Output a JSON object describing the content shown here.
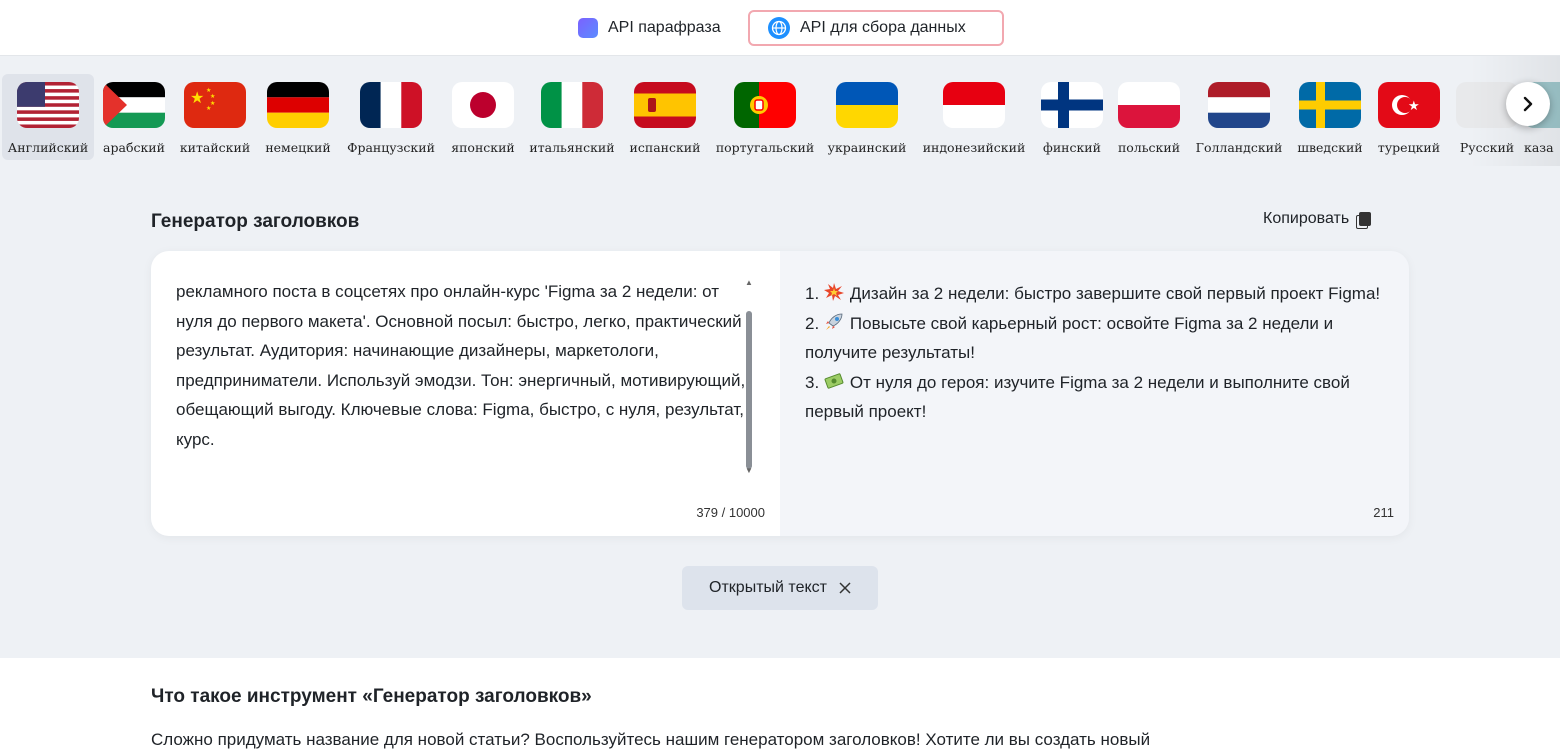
{
  "topbar": {
    "paraphrase_api": "API парафраза",
    "data_api": "API для сбора данных"
  },
  "languages": [
    {
      "label": "Английский",
      "flag": "us-flag-icon",
      "active": true
    },
    {
      "label": "арабский",
      "flag": "palestine-flag-icon"
    },
    {
      "label": "китайский",
      "flag": "china-flag-icon"
    },
    {
      "label": "немецкий",
      "flag": "germany-flag-icon"
    },
    {
      "label": "Французский",
      "flag": "france-flag-icon"
    },
    {
      "label": "японский",
      "flag": "japan-flag-icon"
    },
    {
      "label": "итальянский",
      "flag": "italy-flag-icon"
    },
    {
      "label": "испанский",
      "flag": "spain-flag-icon"
    },
    {
      "label": "португальский",
      "flag": "portugal-flag-icon"
    },
    {
      "label": "украинский",
      "flag": "ukraine-flag-icon"
    },
    {
      "label": "индонезийский",
      "flag": "indonesia-flag-icon"
    },
    {
      "label": "финский",
      "flag": "finland-flag-icon"
    },
    {
      "label": "польский",
      "flag": "poland-flag-icon"
    },
    {
      "label": "Голландский",
      "flag": "netherlands-flag-icon"
    },
    {
      "label": "шведский",
      "flag": "sweden-flag-icon"
    },
    {
      "label": "турецкий",
      "flag": "turkey-flag-icon"
    },
    {
      "label": "Русский",
      "flag": "russian-flag-icon"
    },
    {
      "label": "каза",
      "flag": "kazakhstan-flag-icon"
    }
  ],
  "tool": {
    "title": "Генератор заголовков",
    "copy_label": "Копировать",
    "input": "рекламного поста в соцсетях про онлайн-курс 'Figma за 2 недели: от нуля до первого макета'. Основной посыл: быстро, легко, практический результат. Аудитория: начинающие дизайнеры, маркетологи, предприниматели. Используй эмодзи. Тон: энергичный, мотивирующий, обещающий выгоду. Ключевые слова: Figma, быстро, с нуля, результат, курс.",
    "input_counter": "379 / 10000",
    "output": [
      {
        "num": "1.",
        "emoji": "collision-emoji-icon",
        "text": "Дизайн за 2 недели: быстро завершите свой первый проект Figma!"
      },
      {
        "num": "2.",
        "emoji": "rocket-emoji-icon",
        "text": "Повысьте свой карьерный рост: освойте Figma за 2 недели и получите результаты!"
      },
      {
        "num": "3.",
        "emoji": "money-emoji-icon",
        "text": "От нуля до героя: изучите Figma за 2 недели и выполните свой первый проект!"
      }
    ],
    "output_counter": "211",
    "open_text_label": "Открытый текст"
  },
  "about": {
    "title": "Что такое инструмент «Генератор заголовков»",
    "text": "Сложно придумать название для новой статьи? Воспользуйтесь нашим генератором заголовков! Хотите ли вы создать новый"
  }
}
